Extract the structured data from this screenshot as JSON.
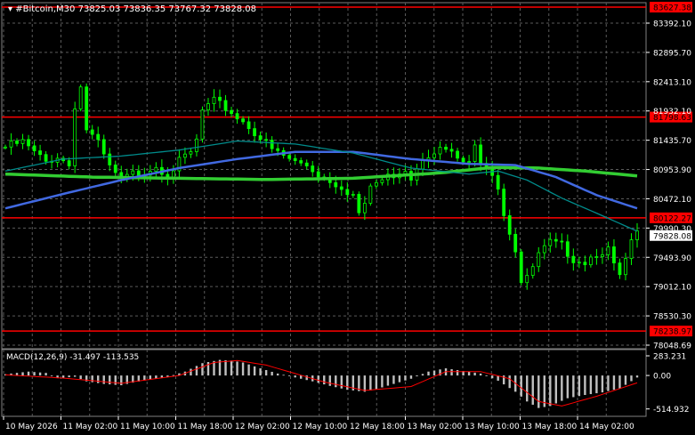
{
  "window": {
    "symbol_timeframe": "#Bitcoin,M30",
    "ohlc": "73825.03 73836.35 73767.32 73828.08"
  },
  "colors": {
    "background": "#000000",
    "grid": "#5a5a5a",
    "candle_up": "#00ff00",
    "candle_down": "#00ff00",
    "sma_fast": "#008b8b",
    "sma_mid": "#4169e1",
    "sma_slow": "#32cd32",
    "hline": "#ff0000",
    "hline_label_bg": "#ff0000",
    "price_label_bg": "#ffffff",
    "macd_hist": "#c0c0c0",
    "macd_signal": "#ff0000"
  },
  "chart_data": [
    {
      "type": "candlestick",
      "panel": "main",
      "ylim": [
        78048.69,
        83627.38
      ],
      "y_ticks": [
        "83392.10",
        "82895.70",
        "82413.10",
        "81932.10",
        "81435.70",
        "80953.90",
        "80472.10",
        "79990.30",
        "79493.90",
        "79012.10",
        "78530.30",
        "78048.69"
      ],
      "x_ticks": [
        "10 May 2026",
        "11 May 02:00",
        "11 May 10:00",
        "11 May 18:00",
        "12 May 02:00",
        "12 May 10:00",
        "12 May 18:00",
        "13 May 02:00",
        "13 May 10:00",
        "13 May 18:00",
        "14 May 02:00"
      ],
      "current_price": "79828.08",
      "horizontal_lines": [
        {
          "value": 83627.38,
          "label": "83627.38"
        },
        {
          "value": 81798.63,
          "label": "81798.63"
        },
        {
          "value": 80122.27,
          "label": "80122.27"
        },
        {
          "value": 78238.97,
          "label": "78238.97"
        }
      ],
      "close_path": [
        [
          0,
          81300
        ],
        [
          3,
          81380
        ],
        [
          5,
          81200
        ],
        [
          7,
          81050
        ],
        [
          9,
          81150
        ],
        [
          11,
          81000
        ],
        [
          12,
          82000
        ],
        [
          13,
          82300
        ],
        [
          14,
          81600
        ],
        [
          16,
          81350
        ],
        [
          18,
          80950
        ],
        [
          20,
          80750
        ],
        [
          22,
          80850
        ],
        [
          24,
          80900
        ],
        [
          26,
          81000
        ],
        [
          28,
          80850
        ],
        [
          30,
          81050
        ],
        [
          32,
          81200
        ],
        [
          33,
          81400
        ],
        [
          34,
          81900
        ],
        [
          36,
          82050
        ],
        [
          38,
          81950
        ],
        [
          40,
          81800
        ],
        [
          42,
          81650
        ],
        [
          44,
          81450
        ],
        [
          46,
          81250
        ],
        [
          48,
          81150
        ],
        [
          50,
          81050
        ],
        [
          52,
          81000
        ],
        [
          54,
          80850
        ],
        [
          56,
          80750
        ],
        [
          58,
          80650
        ],
        [
          60,
          80500
        ],
        [
          61,
          80200
        ],
        [
          62,
          80300
        ],
        [
          63,
          80650
        ],
        [
          65,
          80750
        ],
        [
          67,
          80850
        ],
        [
          69,
          80950
        ],
        [
          70,
          80800
        ],
        [
          72,
          81150
        ],
        [
          74,
          81250
        ],
        [
          76,
          81250
        ],
        [
          78,
          81100
        ],
        [
          80,
          81000
        ],
        [
          81,
          81300
        ],
        [
          82,
          81100
        ],
        [
          84,
          80900
        ],
        [
          85,
          80650
        ],
        [
          86,
          80200
        ],
        [
          87,
          79900
        ],
        [
          88,
          79600
        ],
        [
          89,
          79050
        ],
        [
          90,
          79100
        ],
        [
          91,
          79300
        ],
        [
          92,
          79500
        ],
        [
          94,
          79700
        ],
        [
          96,
          79650
        ],
        [
          98,
          79450
        ],
        [
          100,
          79400
        ],
        [
          102,
          79550
        ],
        [
          104,
          79600
        ],
        [
          105,
          79300
        ],
        [
          106,
          79150
        ],
        [
          107,
          79400
        ],
        [
          108,
          79700
        ],
        [
          109,
          79828
        ]
      ],
      "moving_averages": [
        {
          "color_key": "sma_slow",
          "values": [
            [
              0,
              80850
            ],
            [
              15,
              80800
            ],
            [
              30,
              80780
            ],
            [
              45,
              80760
            ],
            [
              60,
              80780
            ],
            [
              75,
              80870
            ],
            [
              84,
              80960
            ],
            [
              92,
              80950
            ],
            [
              100,
              80900
            ],
            [
              109,
              80820
            ]
          ]
        },
        {
          "color_key": "sma_mid",
          "values": [
            [
              0,
              80280
            ],
            [
              10,
              80520
            ],
            [
              20,
              80750
            ],
            [
              30,
              80950
            ],
            [
              40,
              81100
            ],
            [
              50,
              81220
            ],
            [
              60,
              81220
            ],
            [
              70,
              81100
            ],
            [
              80,
              81020
            ],
            [
              88,
              81000
            ],
            [
              95,
              80800
            ],
            [
              102,
              80500
            ],
            [
              109,
              80280
            ]
          ]
        },
        {
          "color_key": "sma_fast",
          "values": [
            [
              0,
              80900
            ],
            [
              10,
              81100
            ],
            [
              20,
              81150
            ],
            [
              30,
              81250
            ],
            [
              40,
              81400
            ],
            [
              50,
              81350
            ],
            [
              60,
              81200
            ],
            [
              70,
              80950
            ],
            [
              80,
              80850
            ],
            [
              85,
              80900
            ],
            [
              90,
              80750
            ],
            [
              96,
              80450
            ],
            [
              102,
              80200
            ],
            [
              109,
              79900
            ]
          ]
        }
      ]
    },
    {
      "type": "macd",
      "panel": "indicator",
      "label": "MACD(12,26,9) -31.497 -113.535",
      "ylim": [
        -560,
        330
      ],
      "y_ticks": [
        "283.231",
        "0.00",
        "-514.932"
      ],
      "histogram": [
        [
          0,
          20
        ],
        [
          4,
          60
        ],
        [
          7,
          40
        ],
        [
          9,
          -40
        ],
        [
          12,
          -20
        ],
        [
          14,
          -90
        ],
        [
          17,
          -130
        ],
        [
          20,
          -150
        ],
        [
          22,
          -110
        ],
        [
          25,
          -60
        ],
        [
          28,
          -20
        ],
        [
          31,
          60
        ],
        [
          34,
          190
        ],
        [
          37,
          240
        ],
        [
          39,
          230
        ],
        [
          41,
          200
        ],
        [
          44,
          110
        ],
        [
          47,
          30
        ],
        [
          50,
          -30
        ],
        [
          53,
          -90
        ],
        [
          56,
          -160
        ],
        [
          59,
          -220
        ],
        [
          62,
          -250
        ],
        [
          64,
          -210
        ],
        [
          67,
          -130
        ],
        [
          70,
          -50
        ],
        [
          73,
          60
        ],
        [
          76,
          110
        ],
        [
          79,
          70
        ],
        [
          82,
          30
        ],
        [
          85,
          -80
        ],
        [
          88,
          -250
        ],
        [
          90,
          -400
        ],
        [
          92,
          -500
        ],
        [
          94,
          -470
        ],
        [
          97,
          -350
        ],
        [
          100,
          -300
        ],
        [
          103,
          -260
        ],
        [
          106,
          -200
        ],
        [
          109,
          -31
        ]
      ],
      "signal": [
        [
          0,
          10
        ],
        [
          10,
          -40
        ],
        [
          20,
          -120
        ],
        [
          30,
          0
        ],
        [
          36,
          200
        ],
        [
          40,
          230
        ],
        [
          45,
          160
        ],
        [
          55,
          -100
        ],
        [
          62,
          -230
        ],
        [
          70,
          -170
        ],
        [
          76,
          60
        ],
        [
          82,
          60
        ],
        [
          87,
          -50
        ],
        [
          92,
          -400
        ],
        [
          96,
          -470
        ],
        [
          102,
          -320
        ],
        [
          109,
          -113
        ]
      ]
    }
  ]
}
